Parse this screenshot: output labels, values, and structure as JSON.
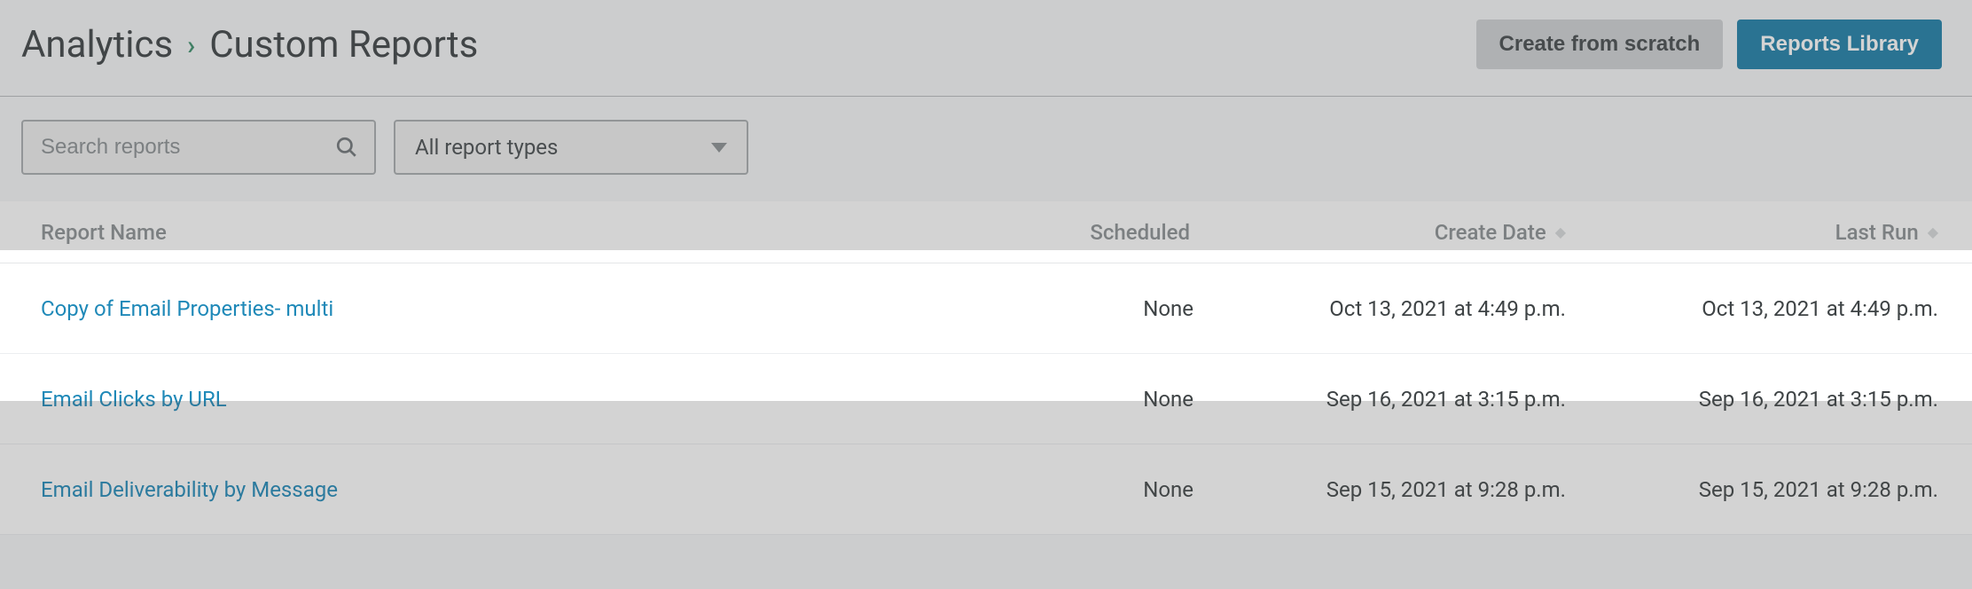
{
  "breadcrumb": {
    "root": "Analytics",
    "current": "Custom Reports"
  },
  "header": {
    "create_from_scratch": "Create from scratch",
    "reports_library": "Reports Library"
  },
  "filters": {
    "search_placeholder": "Search reports",
    "type_label": "All report types"
  },
  "table": {
    "columns": {
      "name": "Report Name",
      "scheduled": "Scheduled",
      "create_date": "Create Date",
      "last_run": "Last Run"
    },
    "rows": [
      {
        "name": "Copy of Email Properties- multi",
        "scheduled": "None",
        "create_date": "Oct 13, 2021 at 4:49 p.m.",
        "last_run": "Oct 13, 2021 at 4:49 p.m.",
        "highlighted": true
      },
      {
        "name": "Email Clicks by URL",
        "scheduled": "None",
        "create_date": "Sep 16, 2021 at 3:15 p.m.",
        "last_run": "Sep 16, 2021 at 3:15 p.m.",
        "highlighted": false
      },
      {
        "name": "Email Deliverability by Message",
        "scheduled": "None",
        "create_date": "Sep 15, 2021 at 9:28 p.m.",
        "last_run": "Sep 15, 2021 at 9:28 p.m.",
        "highlighted": false
      }
    ]
  }
}
